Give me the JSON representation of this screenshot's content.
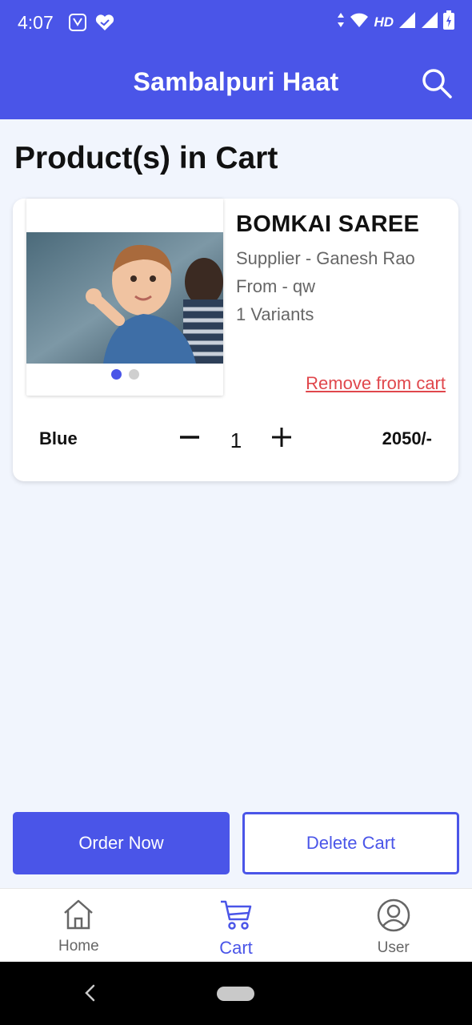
{
  "status_bar": {
    "time": "4:07",
    "network": "HD"
  },
  "app_bar": {
    "title": "Sambalpuri Haat",
    "search_icon": "search-icon"
  },
  "page": {
    "title": "Product(s) in Cart"
  },
  "cart_item": {
    "name": "BOMKAI SAREE",
    "supplier": "Supplier - Ganesh Rao",
    "from": "From - qw",
    "variants": "1 Variants",
    "remove_label": "Remove from cart",
    "image_dots_count": 2,
    "image_active_dot": 1,
    "variant_name": "Blue",
    "quantity": "1",
    "price": "2050/-"
  },
  "actions": {
    "order_label": "Order Now",
    "delete_label": "Delete Cart"
  },
  "bottom_nav": {
    "items": [
      {
        "label": "Home",
        "icon": "home-icon"
      },
      {
        "label": "Cart",
        "icon": "cart-icon"
      },
      {
        "label": "User",
        "icon": "user-icon"
      }
    ],
    "active": "Cart"
  },
  "colors": {
    "primary": "#4a55e8",
    "danger": "#e0474c",
    "background": "#f1f5fd"
  }
}
